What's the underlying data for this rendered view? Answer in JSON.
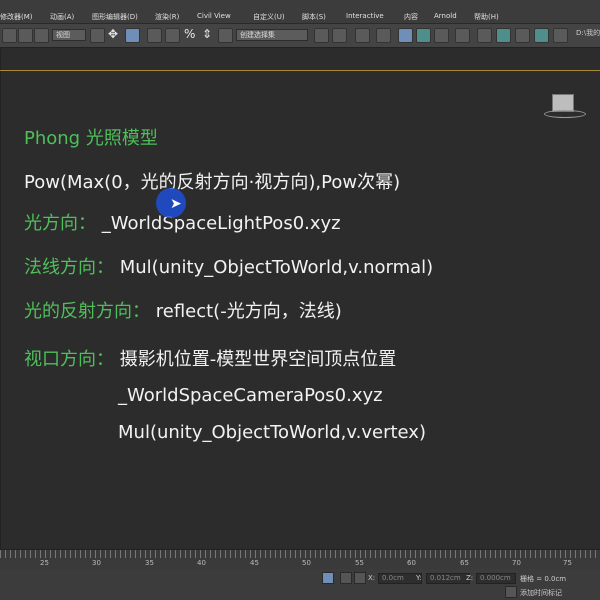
{
  "menubar": {
    "items": [
      "修改器(M)",
      "动画(A)",
      "图形编辑器(D)",
      "渲染(R)",
      "Civil View",
      "自定义(U)",
      "脚本(S)",
      "Interactive",
      "内容",
      "Arnold",
      "帮助(H)"
    ]
  },
  "toolbar": {
    "view_combo": "视图",
    "selection_set_combo": "创建选择集",
    "path": "D:\\我的"
  },
  "viewport": {
    "lines": [
      {
        "label": "Phong  光照模型",
        "value": ""
      },
      {
        "label": "",
        "value": "Pow(Max(0，光的反射方向·视方向),Pow次幂)"
      },
      {
        "label": "光方向：",
        "value": "_WorldSpaceLightPos0.xyz"
      },
      {
        "label": "法线方向：",
        "value": "Mul(unity_ObjectToWorld,v.normal)"
      },
      {
        "label": "光的反射方向：",
        "value": "reflect(-光方向，法线)"
      },
      {
        "label": "视口方向：",
        "value": "摄影机位置-模型世界空间顶点位置"
      },
      {
        "label": "",
        "value": "_WorldSpaceCameraPos0.xyz"
      },
      {
        "label": "",
        "value": "Mul(unity_ObjectToWorld,v.vertex)"
      }
    ],
    "colors": {
      "label": "#4fbf5a",
      "text": "#f2f2f2",
      "frame": "#a88a3a",
      "cursor": "#1f4fd8"
    }
  },
  "timeline": {
    "tick_labels": [
      "25",
      "30",
      "35",
      "40",
      "45",
      "50",
      "55",
      "60",
      "65",
      "70",
      "75"
    ]
  },
  "status": {
    "x_label": "X:",
    "x_value": "0.0cm",
    "y_label": "Y:",
    "y_value": "0.012cm",
    "z_label": "Z:",
    "z_value": "0.000cm",
    "grid_label": "栅格 = 0.0cm",
    "add_time_tag": "添加时间标记"
  }
}
